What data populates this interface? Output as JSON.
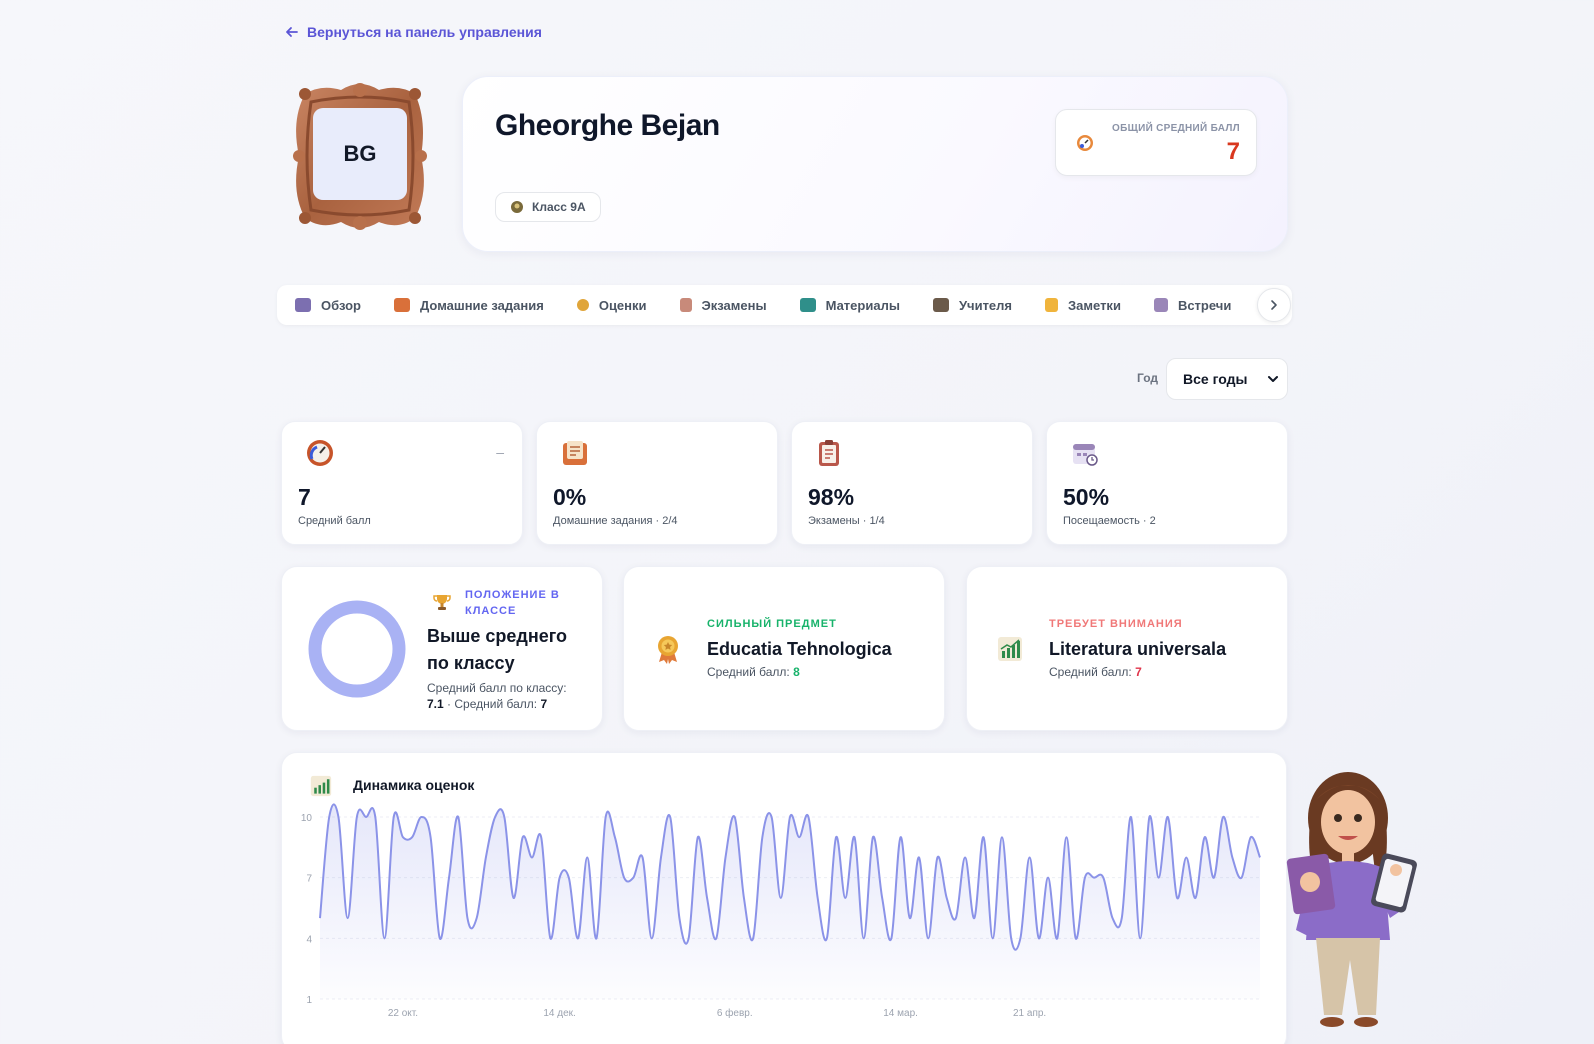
{
  "nav": {
    "back_label": "Вернуться на панель управления"
  },
  "profile": {
    "initials": "BG",
    "name": "Gheorghe Bejan",
    "class_chip": "Класс 9А",
    "overall_avg_label": "ОБЩИЙ СРЕДНИЙ БАЛЛ",
    "overall_avg_value": "7"
  },
  "tabs": [
    {
      "label": "Обзор",
      "icon": "overview-icon",
      "color": "#7c6fb0"
    },
    {
      "label": "Домашние задания",
      "icon": "homework-icon",
      "color": "#d9703a"
    },
    {
      "label": "Оценки",
      "icon": "grades-icon",
      "color": "#e0a53a"
    },
    {
      "label": "Экзамены",
      "icon": "exams-icon",
      "color": "#c88a7a"
    },
    {
      "label": "Материалы",
      "icon": "materials-icon",
      "color": "#2f8f8a"
    },
    {
      "label": "Учителя",
      "icon": "teachers-icon",
      "color": "#6b5a4a"
    },
    {
      "label": "Заметки",
      "icon": "notes-icon",
      "color": "#f0b43c"
    },
    {
      "label": "Встречи",
      "icon": "meetings-icon",
      "color": "#9a86b8"
    }
  ],
  "filter": {
    "year_label": "Год",
    "year_value": "Все годы"
  },
  "stats": [
    {
      "value": "7",
      "label": "Средний балл",
      "icon": "speedometer-icon",
      "trend": "–"
    },
    {
      "value": "0%",
      "label": "Домашние задания · 2/4",
      "icon": "homework-book-icon"
    },
    {
      "value": "98%",
      "label": "Экзамены · 1/4",
      "icon": "clipboard-icon"
    },
    {
      "value": "50%",
      "label": "Посещаемость · 2",
      "icon": "calendar-icon"
    }
  ],
  "position": {
    "kicker": "ПОЛОЖЕНИЕ В КЛАССЕ",
    "headline_line1": "Выше среднего",
    "headline_line2": "по классу",
    "class_avg_label": "Средний балл по классу:",
    "class_avg_value": "7.1",
    "student_avg_label": "· Средний балл:",
    "student_avg_value": "7"
  },
  "strong": {
    "kicker": "СИЛЬНЫЙ ПРЕДМЕТ",
    "subject": "Educatia Tehnologica",
    "avg_label": "Средний балл:",
    "avg_value": "8",
    "color": "#18b36b"
  },
  "attention": {
    "kicker": "ТРЕБУЕТ ВНИМАНИЯ",
    "subject": "Literatura universala",
    "avg_label": "Средний балл:",
    "avg_value": "7",
    "color": "#f07878"
  },
  "chart_data": {
    "type": "area",
    "title": "Динамика оценок",
    "yticks": [
      10,
      7,
      4,
      1
    ],
    "ylim": [
      1,
      10
    ],
    "xtick_labels": [
      "22 окт.",
      "14 дек.",
      "6 февр.",
      "14 мар.",
      "21 апр."
    ],
    "xtick_index": [
      9,
      26,
      45,
      63,
      77
    ],
    "grid": true,
    "values": [
      5,
      10,
      10,
      5,
      10,
      10,
      10,
      4,
      10,
      9,
      9,
      10,
      9,
      4,
      7,
      10,
      5,
      5,
      8,
      10,
      10,
      6,
      9,
      8,
      9,
      4,
      7,
      7,
      4,
      8,
      4,
      10,
      9,
      7,
      7,
      8,
      4,
      8,
      10,
      5,
      4,
      9,
      6,
      4,
      8,
      10,
      6,
      4,
      9,
      10,
      6,
      10,
      9,
      10,
      6,
      4,
      9,
      6,
      9,
      4,
      9,
      6,
      4,
      9,
      5,
      8,
      4,
      8,
      6,
      5,
      8,
      5,
      9,
      4,
      9,
      4,
      4,
      8,
      4,
      7,
      4,
      9,
      4,
      7,
      7,
      7,
      5,
      5,
      10,
      4,
      10,
      7,
      10,
      6,
      8,
      6,
      9,
      7,
      10,
      8,
      7,
      9,
      8
    ],
    "color": "#8b93e8"
  }
}
